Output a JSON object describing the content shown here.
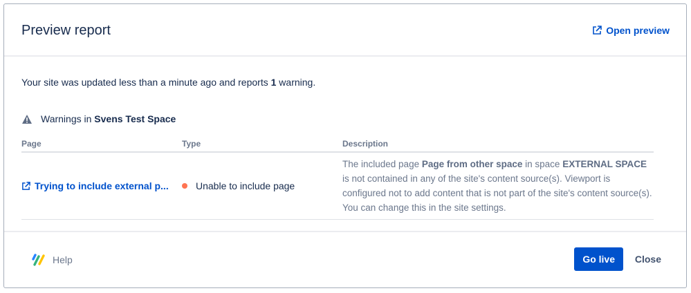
{
  "header": {
    "title": "Preview report",
    "open_preview": "Open preview"
  },
  "summary": {
    "prefix": "Your site was updated less than a minute ago and reports ",
    "count": "1",
    "suffix": " warning."
  },
  "warnings": {
    "prefix": "Warnings in ",
    "space": "Svens Test Space"
  },
  "table": {
    "headers": [
      "Page",
      "Type",
      "Description"
    ],
    "rows": [
      {
        "page": "Trying to include external p...",
        "type": "Unable to include page",
        "desc": {
          "t1": "The included page ",
          "b1": "Page from other space",
          "t2": " in space ",
          "b2": "EXTERNAL SPACE",
          "t3": " is not contained in any of the site's content source(s). Viewport is configured not to add content that is not part of the site's content source(s). You can change this in the site settings."
        }
      }
    ]
  },
  "footer": {
    "help": "Help",
    "go_live": "Go live",
    "close": "Close"
  },
  "colors": {
    "accent": "#0052cc",
    "warning_dot": "#ff7452"
  }
}
